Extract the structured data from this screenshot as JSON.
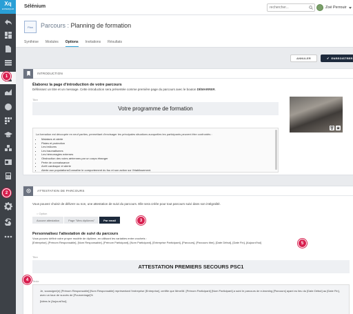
{
  "app": {
    "logo": "Xq",
    "logo_sub": "EXPERQUIZ",
    "title": "Sélénium"
  },
  "search": {
    "placeholder": "rechercher..."
  },
  "user": {
    "name": "Zoé Perrouir"
  },
  "header": {
    "thumb_label": "Plan",
    "title_prefix": "Parcours :",
    "title": "Planning de formation"
  },
  "tabs": [
    {
      "label": "Synthèse"
    },
    {
      "label": "Modules"
    },
    {
      "label": "Options"
    },
    {
      "label": "Invitations"
    },
    {
      "label": "Résultats"
    }
  ],
  "actions": {
    "cancel": "ANNULER",
    "save": "ENREGISTRER"
  },
  "intro": {
    "section_title": "INTRODUCTION",
    "heading": "Élaborez la page d'introduction de votre parcours",
    "desc_before": "Définissez un titre et un message. Cette introduction sera présentée comme première page du parcours avec le bouton ",
    "desc_strong": "DÉMARRER",
    "desc_after": ".",
    "title_label": "Titre",
    "title_value": "Votre programme de formation",
    "body_intro": "La formation est découpée en neuf parties, permettant d'envisager les principales situations auxquelles les participants peuvent être confrontés :",
    "items": [
      "Malaises et alerte",
      "Plaies et protection",
      "Les brûlures",
      "Les traumatismes",
      "Les hémorragies externes",
      "Obstruction des voies aériennes par un corps étranger",
      "Perte de connaissance",
      "Arrêt cardiaque et alerte",
      "Alerte aux populationsConnaître le comportement du fou et son action sur l'établissement."
    ]
  },
  "attest": {
    "section_title": "ATTESTATION DE PARCOURS",
    "desc": "Vous pouvez choisir de délivrer ou non, une attestation de suivi du parcours. Elle sera créée pour tout parcours suivi dans son intégralité.",
    "option_label": "Option",
    "options": [
      {
        "label": "Aucune attestation"
      },
      {
        "label": "Page \"Mes diplômes\""
      },
      {
        "label": "Par email"
      }
    ],
    "custom_heading": "Personnalisez l'attestation de suivi du parcours",
    "custom_desc": "Vous pouvez définir votre propre modèle de diplôme, en utilisant les variables entre crochets :",
    "variables": "[Entreprise], [Prénom Responsable], [Nom Responsable], [Prénom Participant], [Nom Participant], [Entreprise Participant], [Parcours], [Parcours titre], [Date Début], [Date Fin], [Aujourd'hui]",
    "title_label": "Titre",
    "title_value": "ATTESTATION PREMIERS SECOURS PSC1",
    "text_label": "Texte",
    "text_line1": "Je, soussigné(e) [Prénom Responsable] [Nom Responsable] représentant l'entreprise [Entreprise], certifie que Mme/M. [Prénom Participant] [Nom Participant] a suivi le parcours de e-learning [Parcours] ayant eu lieu du [Date Début] au [Date Fin], avec un taux de succès de [Pourcentage]%",
    "text_line2": "[Idées le [Aujourd'hui]."
  },
  "markers": [
    "1",
    "2",
    "3",
    "4",
    "5"
  ],
  "colors": {
    "accent": "#2a9fd6",
    "dark": "#1d2a3c",
    "marker": "#d81f4f",
    "sidebar": "#3d4147"
  }
}
